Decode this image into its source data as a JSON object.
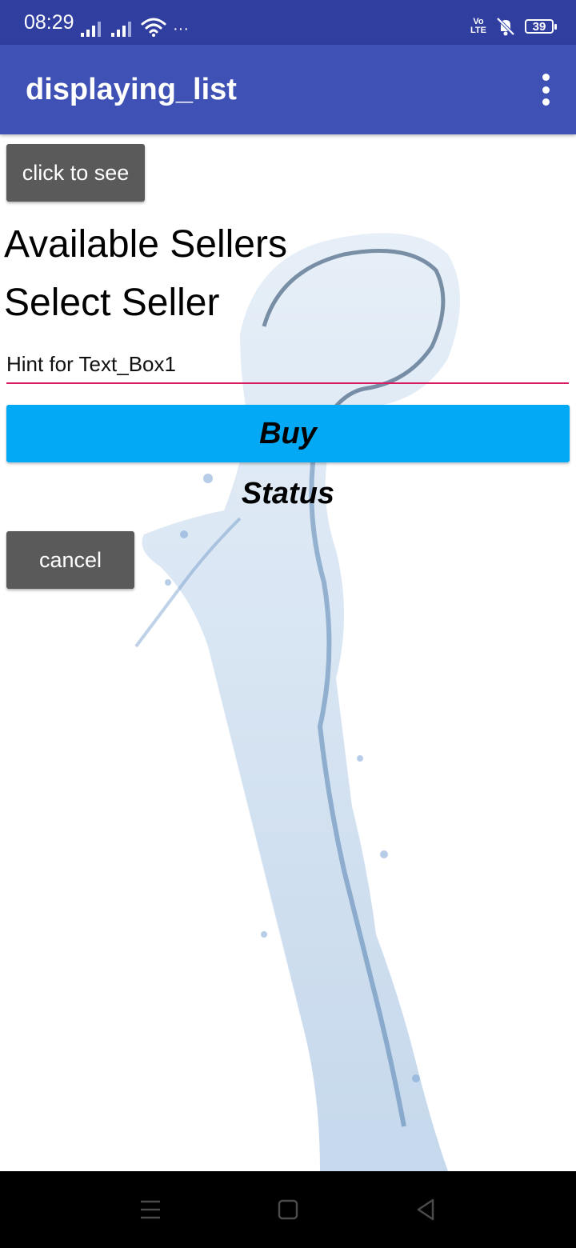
{
  "status_bar": {
    "time": "08:29",
    "more_indicator": "···",
    "volte_line1": "Vo",
    "volte_line2": "LTE",
    "battery_level": "39",
    "icons": [
      "signal-icon",
      "signal-icon",
      "wifi-icon",
      "volte-icon",
      "mute-icon",
      "battery-icon"
    ]
  },
  "app_bar": {
    "title": "displaying_list",
    "menu_icon": "overflow-menu-icon"
  },
  "main": {
    "click_button_label": "click to see",
    "available_sellers_label": "Available Sellers",
    "select_seller_label": "Select Seller",
    "text_box_hint": "Hint for Text_Box1",
    "buy_button_label": "Buy",
    "status_label": "Status",
    "cancel_button_label": "cancel"
  },
  "nav_bar": {
    "icons": [
      "menu-icon",
      "home-icon",
      "back-icon"
    ]
  },
  "colors": {
    "status_bar": "#303f9f",
    "app_bar": "#3f51b5",
    "buy_button": "#03a9f4",
    "grey_button": "#5a5a5a",
    "text_box_underline": "#d81b60"
  }
}
